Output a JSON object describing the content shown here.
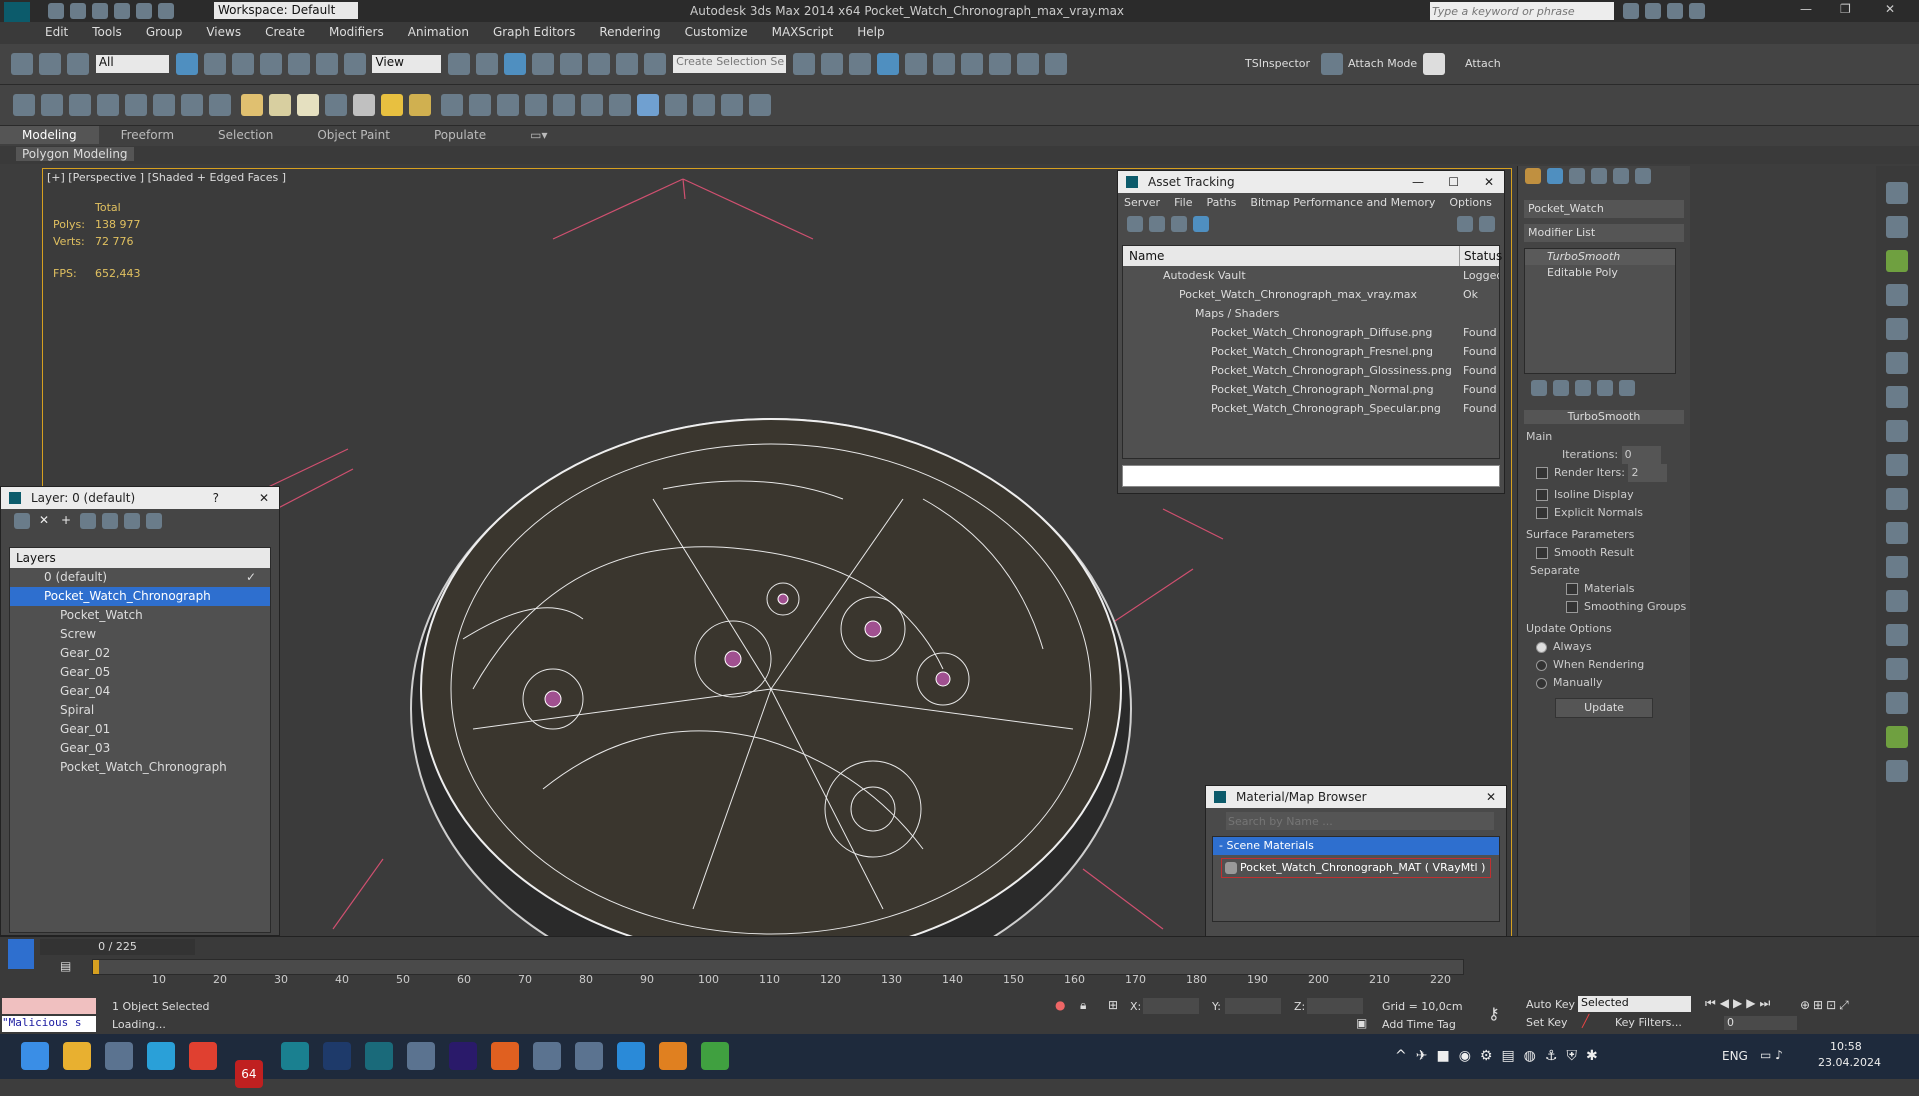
{
  "titlebar": {
    "workspace_label": "Workspace: Default",
    "title": "Autodesk 3ds Max  2014 x64     Pocket_Watch_Chronograph_max_vray.max",
    "search_placeholder": "Type a keyword or phrase"
  },
  "menu": [
    "Edit",
    "Tools",
    "Group",
    "Views",
    "Create",
    "Modifiers",
    "Animation",
    "Graph Editors",
    "Rendering",
    "Customize",
    "MAXScript",
    "Help"
  ],
  "toolbar": {
    "filter_value": "All",
    "view_value": "View",
    "selection_set_placeholder": "Create Selection Se",
    "ts_inspector": "TSInspector",
    "attach_mode": "Attach Mode",
    "attach": "Attach"
  },
  "ribbon": {
    "tabs": [
      "Modeling",
      "Freeform",
      "Selection",
      "Object Paint",
      "Populate"
    ],
    "sub": "Polygon Modeling"
  },
  "viewport": {
    "label": "[+] [Perspective ] [Shaded + Edged Faces ]",
    "stats_total": "Total",
    "polys_label": "Polys:",
    "polys_value": "138 977",
    "verts_label": "Verts:",
    "verts_value": "72 776",
    "fps_label": "FPS:",
    "fps_value": "652,443"
  },
  "layer_panel": {
    "title": "Layer: 0 (default)",
    "header": "Layers",
    "items": [
      "0 (default)",
      "Pocket_Watch_Chronograph",
      "Pocket_Watch",
      "Screw",
      "Gear_02",
      "Gear_05",
      "Gear_04",
      "Spiral",
      "Gear_01",
      "Gear_03",
      "Pocket_Watch_Chronograph"
    ]
  },
  "asset_tracking": {
    "title": "Asset Tracking",
    "menu": [
      "Server",
      "File",
      "Paths",
      "Bitmap Performance and Memory",
      "Options"
    ],
    "col_name": "Name",
    "col_status": "Status",
    "rows": [
      {
        "name": "Autodesk Vault",
        "status": "Logged"
      },
      {
        "name": "Pocket_Watch_Chronograph_max_vray.max",
        "status": "Ok"
      },
      {
        "name": "Maps / Shaders",
        "status": ""
      },
      {
        "name": "Pocket_Watch_Chronograph_Diffuse.png",
        "status": "Found"
      },
      {
        "name": "Pocket_Watch_Chronograph_Fresnel.png",
        "status": "Found"
      },
      {
        "name": "Pocket_Watch_Chronograph_Glossiness.png",
        "status": "Found"
      },
      {
        "name": "Pocket_Watch_Chronograph_Normal.png",
        "status": "Found"
      },
      {
        "name": "Pocket_Watch_Chronograph_Specular.png",
        "status": "Found"
      }
    ]
  },
  "material_browser": {
    "title": "Material/Map Browser",
    "search_placeholder": "Search by Name ...",
    "section": "- Scene Materials",
    "material": "Pocket_Watch_Chronograph_MAT  ( VRayMtl )"
  },
  "command_panel": {
    "object_name": "Pocket_Watch",
    "modifier_list": "Modifier List",
    "stack": [
      "TurboSmooth",
      "Editable Poly"
    ],
    "rollout_title": "TurboSmooth",
    "main_label": "Main",
    "iterations_label": "Iterations:",
    "iterations_value": "0",
    "render_iters_label": "Render Iters:",
    "render_iters_value": "2",
    "isoline": "Isoline Display",
    "explicit_normals": "Explicit Normals",
    "surface_params": "Surface Parameters",
    "smooth_result": "Smooth Result",
    "separate": "Separate",
    "materials": "Materials",
    "smoothing_groups": "Smoothing Groups",
    "update_options": "Update Options",
    "always": "Always",
    "when_rendering": "When Rendering",
    "manually": "Manually",
    "update_button": "Update"
  },
  "timeline": {
    "frame_label": "0 / 225",
    "ticks": [
      "10",
      "20",
      "30",
      "40",
      "50",
      "60",
      "70",
      "80",
      "90",
      "100",
      "110",
      "120",
      "130",
      "140",
      "150",
      "160",
      "170",
      "180",
      "190",
      "200",
      "210",
      "220"
    ]
  },
  "status": {
    "maxscript": "\"Malicious s",
    "selected": "1 Object Selected",
    "loading": "Loading...",
    "x_label": "X:",
    "y_label": "Y:",
    "z_label": "Z:",
    "grid": "Grid = 10,0cm",
    "add_time_tag": "Add Time Tag",
    "auto_key": "Auto Key",
    "set_key": "Set Key",
    "selected_value": "Selected",
    "key_filters": "Key Filters...",
    "frame_value": "0"
  },
  "taskbar": {
    "lang": "ENG",
    "time": "10:58",
    "date": "23.04.2024",
    "badge": "64"
  }
}
